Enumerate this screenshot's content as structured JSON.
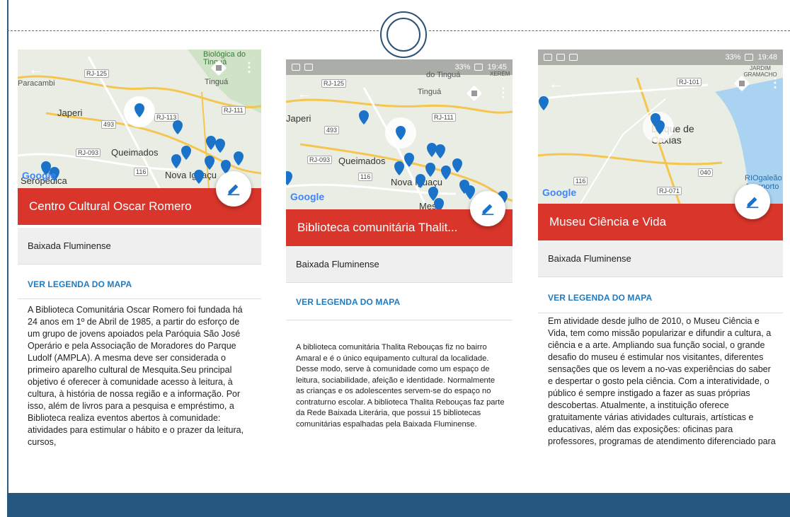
{
  "cards": [
    {
      "map_labels": [
        "RJ-125",
        "Paracambi",
        "Tinguá",
        "Biológica do Tinguá",
        "Japeri",
        "RJ-113",
        "RJ-111",
        "493",
        "RJ-093",
        "Queimados",
        "116",
        "Nova Iguaçu",
        "Seropédica"
      ],
      "title": "Centro Cultural Oscar Romero",
      "region": "Baixada Fluminense",
      "legend_link": "VER LEGENDA DO MAPA",
      "description": "A Biblioteca Comunitária Oscar Romero foi fundada há 24 anos em 1º de Abril de 1985, a partir do esforço de um grupo de jovens apoiados pela Paróquia São José Operário e pela Associação de Moradores do Parque Ludolf (AMPLA). A mesma deve ser considerada o primeiro aparelho cultural de Mesquita.Seu principal objetivo é oferecer à comunidade acesso à leitura, à cultura, à história de nossa região e a informação. Por isso, além de livros para a pesquisa e empréstimo, a Biblioteca realiza eventos abertos à comunidade: atividades para estimular o hábito e o prazer da leitura, cursos,"
    },
    {
      "status_time": "19:45",
      "status_battery": "33%",
      "map_labels": [
        "RJ-125",
        "do Tinguá",
        "XERÉM",
        "Tinguá",
        "Japeri",
        "RJ-111",
        "493",
        "RJ-093",
        "Queimados",
        "116",
        "Nova Iguaçu",
        "Mes"
      ],
      "title": "Biblioteca comunitária Thalit...",
      "region": "Baixada Fluminense",
      "legend_link": "VER LEGENDA DO MAPA",
      "description": "A biblioteca comunitária Thalita Rebouças fiz no bairro Amaral e é o único equipamento cultural da localidade. Desse modo, serve à comunidade como um espaço de leitura, sociabilidade, afeição e identidade. Normalmente as crianças e os adolescentes servem-se do espaço no contraturno escolar. A biblioteca Thalita Rebouças faz parte da Rede Baixada Literária, que possui 15 bibliotecas comunitárias espalhadas pela Baixada Fluminense."
    },
    {
      "status_time": "19:48",
      "status_battery": "33%",
      "map_labels": [
        "JARDIM GRAMACHO",
        "RJ-101",
        "Duque de Caxias",
        "040",
        "116",
        "RJ-071",
        "RIOgaleão Aeroporto"
      ],
      "title": "Museu Ciência e Vida",
      "region": "Baixada Fluminense",
      "legend_link": "VER LEGENDA DO MAPA",
      "description": "Em atividade desde julho de 2010, o Museu Ciência e Vida, tem como missão popularizar e difundir a cultura, a ciência e a arte. Ampliando sua função social, o grande desafio do museu é estimular nos visitantes, diferentes sensações que os levem a no-vas experiências do saber e despertar o gosto pela ciência. Com a interatividade, o público é sempre instigado a fazer as suas próprias descobertas. Atualmente, a instituição oferece gratuitamente várias atividades culturais, artísticas e educativas, além das exposições: oficinas para professores, programas de atendimento diferenciado para"
    }
  ],
  "google_logo": "Google",
  "colors": {
    "title_bar": "#d9352a",
    "link": "#1f7bc1",
    "pin": "#1a73c9",
    "footer": "#25587e"
  },
  "icons": [
    "back-arrow-icon",
    "more-vert-icon",
    "directions-icon",
    "edit-pencil-icon",
    "map-pin-icon"
  ]
}
